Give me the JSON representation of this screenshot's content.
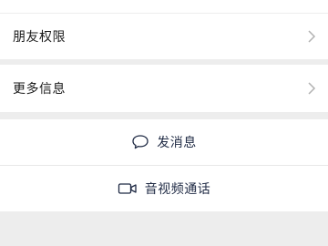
{
  "rows": {
    "friend_permissions": {
      "label": "朋友权限"
    },
    "more_info": {
      "label": "更多信息"
    }
  },
  "actions": {
    "send_message": {
      "label": "发消息",
      "icon": "chat-bubble-icon"
    },
    "video_call": {
      "label": "音视频通话",
      "icon": "video-camera-icon"
    }
  },
  "colors": {
    "background": "#ededed",
    "surface": "#ffffff",
    "action_text": "#1f2a44",
    "chevron": "#b2b2b2"
  }
}
